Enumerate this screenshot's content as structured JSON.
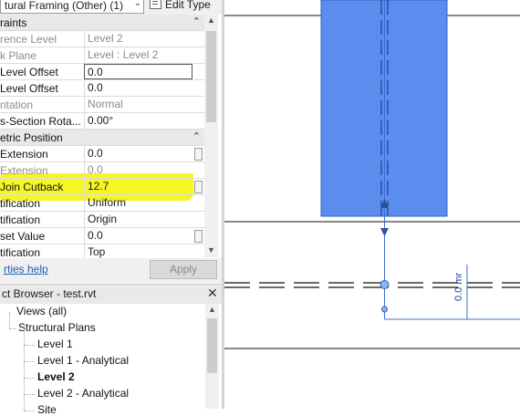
{
  "properties": {
    "type_selector": "tural Framing (Other) (1)",
    "edit_type_label": "Edit Type",
    "rows": [
      {
        "label": "raints",
        "value": "",
        "header": true
      },
      {
        "label": "rence Level",
        "value": "Level 2",
        "grey": true
      },
      {
        "label": "k Plane",
        "value": "Level : Level 2",
        "grey": true
      },
      {
        "label": " Level Offset",
        "value": "0.0",
        "editing": true
      },
      {
        "label": " Level Offset",
        "value": "0.0"
      },
      {
        "label": "ntation",
        "value": "Normal",
        "grey": true
      },
      {
        "label": "s-Section Rota...",
        "value": "0.00°"
      },
      {
        "label": "etric Position",
        "value": "",
        "header": true
      },
      {
        "label": " Extension",
        "value": "0.0"
      },
      {
        "label": " Extension",
        "value": "0.0",
        "grey": true
      },
      {
        "label": "Join Cutback",
        "value": "12.7"
      },
      {
        "label": "tification",
        "value": "Uniform"
      },
      {
        "label": "tification",
        "value": "Origin"
      },
      {
        "label": "set Value",
        "value": "0.0"
      },
      {
        "label": "tification",
        "value": "Top"
      }
    ],
    "help_link": "rties help",
    "apply_label": "Apply"
  },
  "browser": {
    "title": "ct Browser - test.rvt",
    "items": [
      {
        "label": "Views (all)",
        "indent": 0,
        "bold": false
      },
      {
        "label": "Structural Plans",
        "indent": 1,
        "bold": false
      },
      {
        "label": "Level 1",
        "indent": 2,
        "bold": false
      },
      {
        "label": "Level 1 - Analytical",
        "indent": 2,
        "bold": false
      },
      {
        "label": "Level 2",
        "indent": 2,
        "bold": true
      },
      {
        "label": "Level 2 - Analytical",
        "indent": 2,
        "bold": false
      },
      {
        "label": "Site",
        "indent": 2,
        "bold": false
      }
    ]
  },
  "canvas": {
    "dimension_text": "0.0 mr",
    "colors": {
      "beam": "#5b8def",
      "beam_edge": "#2f5fc4",
      "ref_line": "#3b6fd6"
    }
  }
}
